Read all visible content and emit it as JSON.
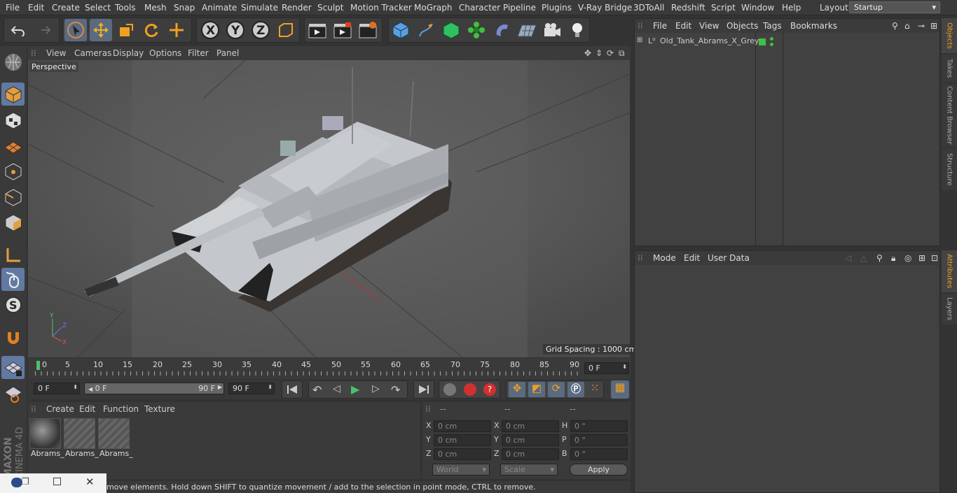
{
  "menu": [
    "File",
    "Edit",
    "Create",
    "Select",
    "Tools",
    "Mesh",
    "Snap",
    "Animate",
    "Simulate",
    "Render",
    "Sculpt",
    "Motion Tracker",
    "MoGraph",
    "Character",
    "Pipeline",
    "Plugins",
    "V-Ray Bridge",
    "3DToAll",
    "Redshift",
    "Script",
    "Window",
    "Help"
  ],
  "layout": {
    "label": "Layout:",
    "value": "Startup"
  },
  "viewport": {
    "menu": [
      "View",
      "Cameras",
      "Display",
      "Options",
      "Filter",
      "Panel"
    ],
    "camera": "Perspective",
    "grid_spacing": "Grid Spacing : 1000 cm"
  },
  "timeline": {
    "ticks": [
      "0",
      "5",
      "10",
      "15",
      "20",
      "25",
      "30",
      "35",
      "40",
      "45",
      "50",
      "55",
      "60",
      "65",
      "70",
      "75",
      "80",
      "85",
      "90"
    ],
    "current": "0 F"
  },
  "transport": {
    "start": "0 F",
    "range_start": "0 F",
    "range_end": "90 F",
    "end": "90 F"
  },
  "materials": {
    "menu": [
      "Create",
      "Edit",
      "Function",
      "Texture"
    ],
    "items": [
      "Abrams_",
      "Abrams_",
      "Abrams_"
    ]
  },
  "coords": {
    "headers": [
      "--",
      "--",
      "--"
    ],
    "rows": [
      {
        "a": "X",
        "av": "0 cm",
        "b": "X",
        "bv": "0 cm",
        "c": "H",
        "cv": "0 °"
      },
      {
        "a": "Y",
        "av": "0 cm",
        "b": "Y",
        "bv": "0 cm",
        "c": "P",
        "cv": "0 °"
      },
      {
        "a": "Z",
        "av": "0 cm",
        "b": "Z",
        "bv": "0 cm",
        "c": "B",
        "cv": "0 °"
      }
    ],
    "mode1": "World",
    "mode2": "Scale",
    "apply": "Apply"
  },
  "status": "move elements. Hold down SHIFT to quantize movement / add to the selection in point mode, CTRL to remove.",
  "objects": {
    "menu": [
      "File",
      "Edit",
      "View",
      "Objects",
      "Tags",
      "Bookmarks"
    ],
    "items": [
      {
        "name": "Old_Tank_Abrams_X_Grey"
      }
    ]
  },
  "attributes": {
    "menu": [
      "Mode",
      "Edit",
      "User Data"
    ]
  },
  "sidetabs": [
    "Objects",
    "Takes",
    "Content Browser",
    "Structure",
    "Attributes",
    "Layers"
  ],
  "branding": "MAXON CINEMA 4D"
}
